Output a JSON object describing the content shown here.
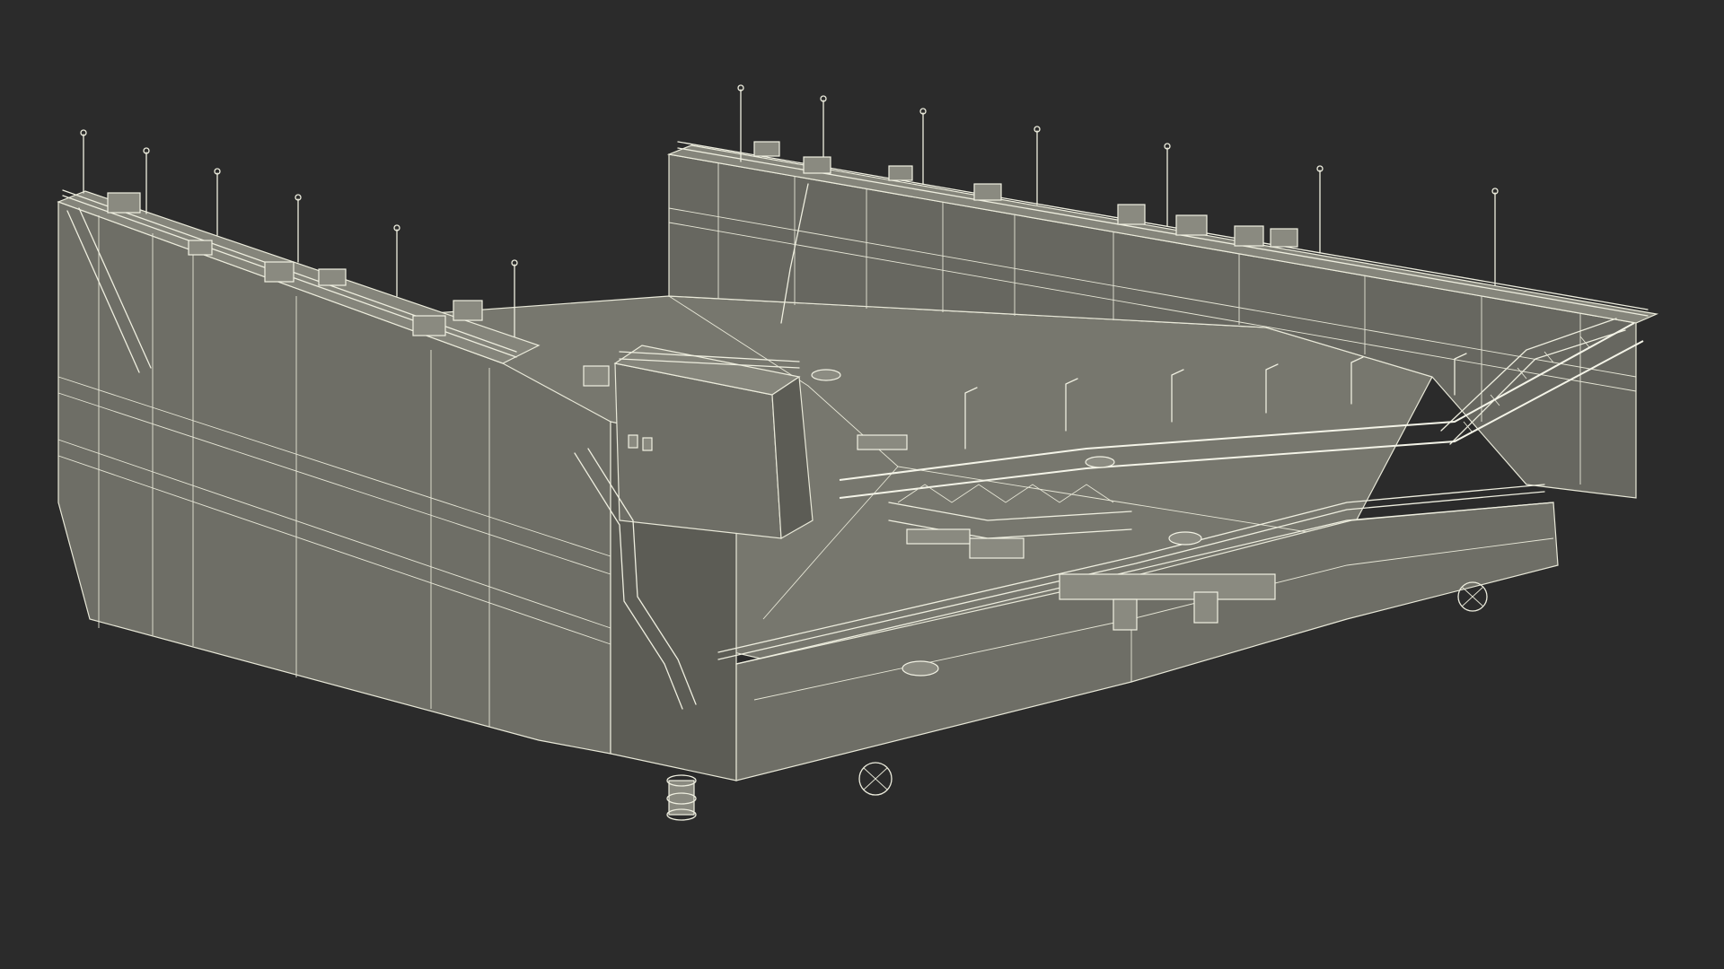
{
  "scene": {
    "background": "#2b2b2b",
    "hull_color": "#6e6e66",
    "wire_color": "#eeeedf"
  }
}
